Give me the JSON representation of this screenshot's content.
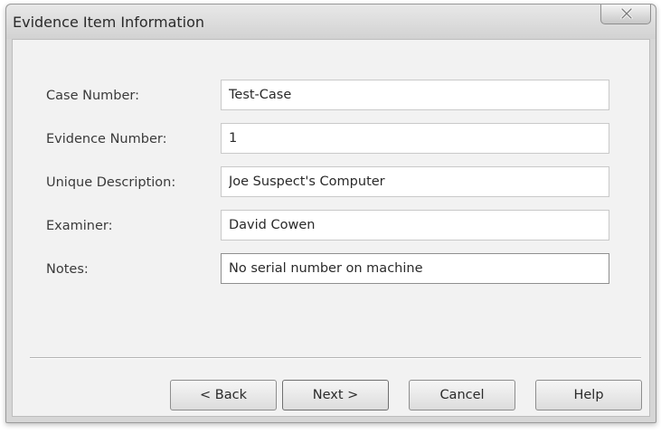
{
  "window": {
    "title": "Evidence Item Information",
    "close_icon": "close-icon"
  },
  "form": {
    "fields": [
      {
        "label": "Case Number:",
        "value": "Test-Case"
      },
      {
        "label": "Evidence Number:",
        "value": "1"
      },
      {
        "label": "Unique Description:",
        "value": "Joe Suspect's Computer"
      },
      {
        "label": "Examiner:",
        "value": "David Cowen"
      },
      {
        "label": "Notes:",
        "value": "No serial number on machine"
      }
    ]
  },
  "buttons": {
    "back": "< Back",
    "next": "Next >",
    "cancel": "Cancel",
    "help": "Help"
  }
}
